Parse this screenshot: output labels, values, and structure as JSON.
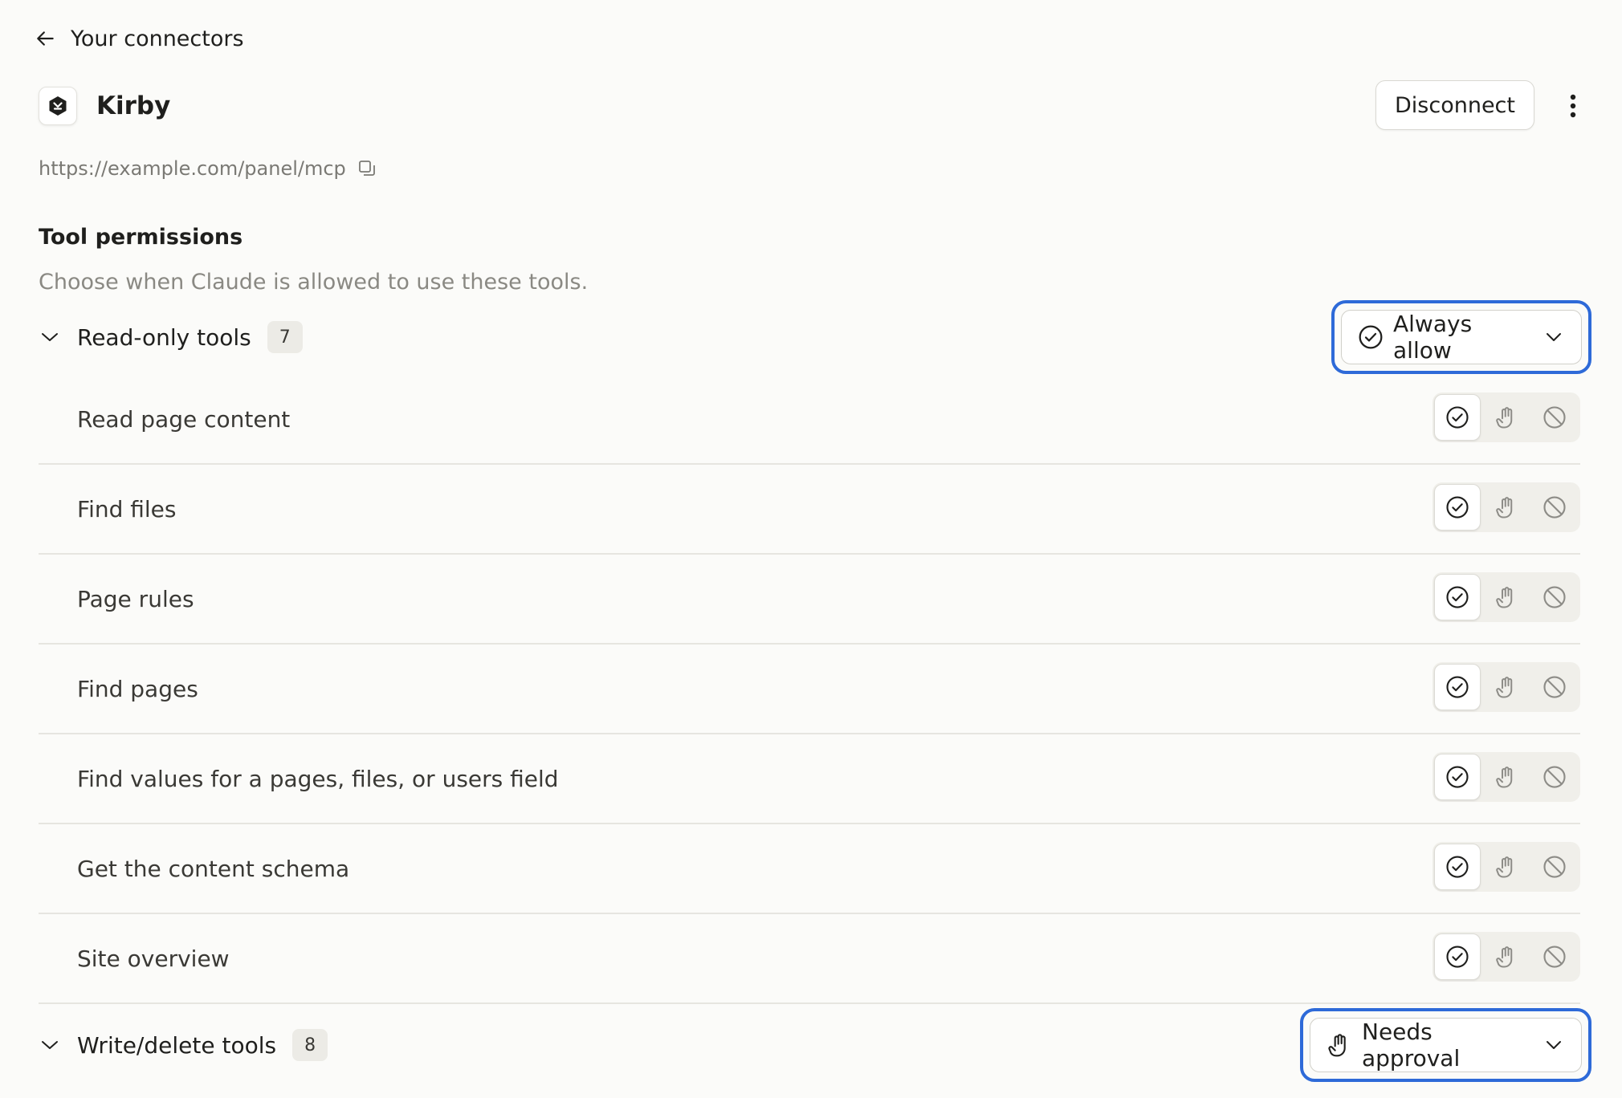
{
  "nav": {
    "back_label": "Your connectors"
  },
  "connector": {
    "name": "Kirby",
    "url": "https://example.com/panel/mcp",
    "disconnect_label": "Disconnect"
  },
  "permissions": {
    "title": "Tool permissions",
    "description": "Choose when Claude is allowed to use these tools.",
    "groups": [
      {
        "label": "Read-only tools",
        "count": "7",
        "policy": "Always allow",
        "policy_icon": "check-circle-icon",
        "tools": [
          {
            "name": "Read page content",
            "selected": "allow"
          },
          {
            "name": "Find files",
            "selected": "allow"
          },
          {
            "name": "Page rules",
            "selected": "allow"
          },
          {
            "name": "Find pages",
            "selected": "allow"
          },
          {
            "name": "Find values for a pages, files, or users field",
            "selected": "allow"
          },
          {
            "name": "Get the content schema",
            "selected": "allow"
          },
          {
            "name": "Site overview",
            "selected": "allow"
          }
        ]
      },
      {
        "label": "Write/delete tools",
        "count": "8",
        "policy": "Needs approval",
        "policy_icon": "hand-icon",
        "tools": []
      }
    ]
  },
  "colors": {
    "focus_ring": "#2e6ad8",
    "background": "#fbfbf9"
  }
}
